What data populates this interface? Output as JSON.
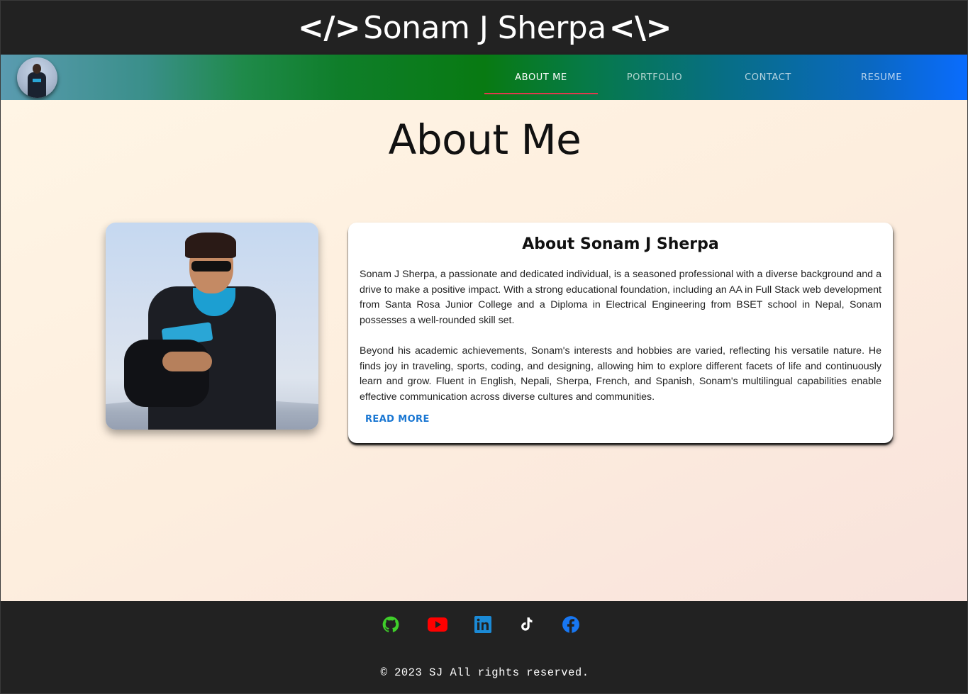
{
  "header": {
    "brand_open": "</>",
    "brand_name": "Sonam J Sherpa",
    "brand_close": "<\\>"
  },
  "nav": {
    "tabs": [
      {
        "label": "ABOUT ME",
        "active": true
      },
      {
        "label": "PORTFOLIO",
        "active": false
      },
      {
        "label": "CONTACT",
        "active": false
      },
      {
        "label": "RESUME",
        "active": false
      }
    ],
    "active_indicator_color": "#e03a4e"
  },
  "main": {
    "title": "About Me",
    "card": {
      "title": "About Sonam J Sherpa",
      "paragraphs": [
        "Sonam J Sherpa, a passionate and dedicated individual, is a seasoned professional with a diverse background and a drive to make a positive impact. With a strong educational foundation, including an AA in Full Stack web development from Santa Rosa Junior College and a Diploma in Electrical Engineering from BSET school in Nepal, Sonam possesses a well-rounded skill set.",
        "Beyond his academic achievements, Sonam's interests and hobbies are varied, reflecting his versatile nature. He finds joy in traveling, sports, coding, and designing, allowing him to explore different facets of life and continuously learn and grow. Fluent in English, Nepali, Sherpa, French, and Spanish, Sonam's multilingual capabilities enable effective communication across diverse cultures and communities."
      ],
      "read_more_label": "READ MORE",
      "link_color": "#1976d2"
    }
  },
  "footer": {
    "social": [
      {
        "icon": "github-icon",
        "color": "#3fcf2a"
      },
      {
        "icon": "youtube-icon",
        "color": "#ff0000"
      },
      {
        "icon": "linkedin-icon",
        "color": "#1b8ad6"
      },
      {
        "icon": "tiktok-icon",
        "color": "#ffffff"
      },
      {
        "icon": "facebook-icon",
        "color": "#1877f2"
      }
    ],
    "copyright": "© 2023 SJ All rights reserved."
  }
}
